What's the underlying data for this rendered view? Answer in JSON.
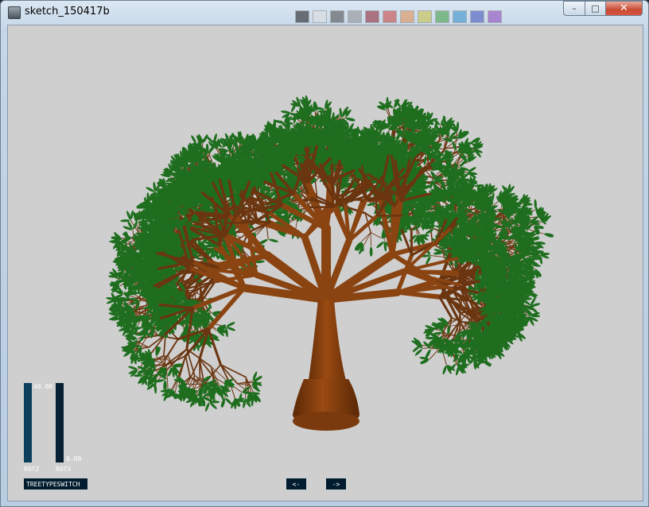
{
  "window": {
    "title": "sketch_150417b",
    "minimize_label": "–",
    "maximize_label": "□",
    "close_label": "✕"
  },
  "controls": {
    "rotz": {
      "label": "ROTZ",
      "value": "40.00",
      "fraction": 1.0
    },
    "rotx": {
      "label": "ROTX",
      "value": "0.00",
      "fraction": 0.0
    },
    "tree_type_switch_label": "TREETYPESWITCH",
    "prev_label": "<-",
    "next_label": "->"
  },
  "colors": {
    "canvas_bg": "#cfcfcf",
    "trunk": "#7a3a0e",
    "leaf": "#1f6e1f",
    "control_bg": "#001c2e",
    "control_fill": "#0b3f5c"
  }
}
